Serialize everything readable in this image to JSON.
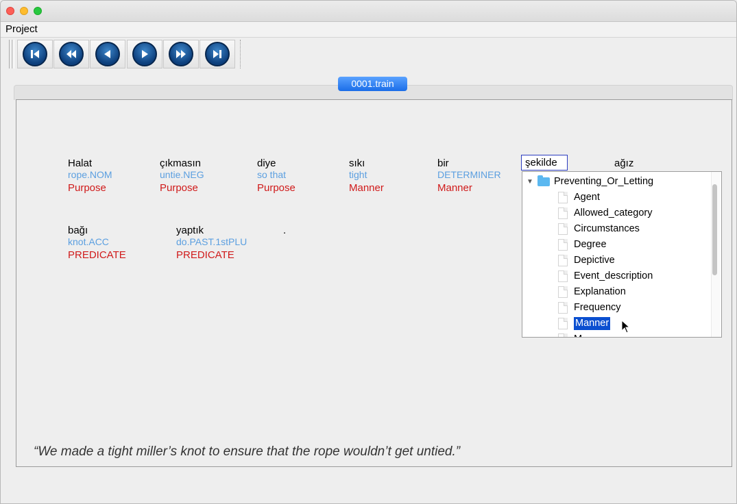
{
  "menubar": {
    "project": "Project"
  },
  "toolbar": {
    "buttons": [
      {
        "name": "first-button",
        "icon": "skip-to-start-icon"
      },
      {
        "name": "rewind-button",
        "icon": "fast-backward-icon"
      },
      {
        "name": "previous-button",
        "icon": "step-backward-icon"
      },
      {
        "name": "next-button",
        "icon": "step-forward-icon"
      },
      {
        "name": "fast-forward-button",
        "icon": "fast-forward-icon"
      },
      {
        "name": "last-button",
        "icon": "skip-to-end-icon"
      }
    ]
  },
  "tab": {
    "label": "0001.train"
  },
  "words": [
    {
      "text": "Halat",
      "gloss": "rope.NOM",
      "role": "Purpose"
    },
    {
      "text": "çıkmasın",
      "gloss": "untie.NEG",
      "role": "Purpose"
    },
    {
      "text": "diye",
      "gloss": "so that",
      "role": "Purpose"
    },
    {
      "text": "sıkı",
      "gloss": "tight",
      "role": "Manner"
    },
    {
      "text": "bir",
      "gloss": "DETERMINER",
      "role": "Manner"
    },
    {
      "text": "ağız",
      "gloss": "",
      "role": ""
    },
    {
      "text": "bağı",
      "gloss": "knot.ACC",
      "role": "PREDICATE"
    },
    {
      "text": "yaptık",
      "gloss": "do.PAST.1stPLU",
      "role": "PREDICATE"
    },
    {
      "text": ".",
      "gloss": "",
      "role": ""
    }
  ],
  "selected_word": "şekilde",
  "tree": {
    "root": "Preventing_Or_Letting",
    "items": [
      "Agent",
      "Allowed_category",
      "Circumstances",
      "Degree",
      "Depictive",
      "Event_description",
      "Explanation",
      "Frequency",
      "Manner",
      "M..."
    ],
    "selected": "Manner"
  },
  "translation": "“We made a tight miller’s knot to ensure that the rope wouldn’t get untied.”"
}
